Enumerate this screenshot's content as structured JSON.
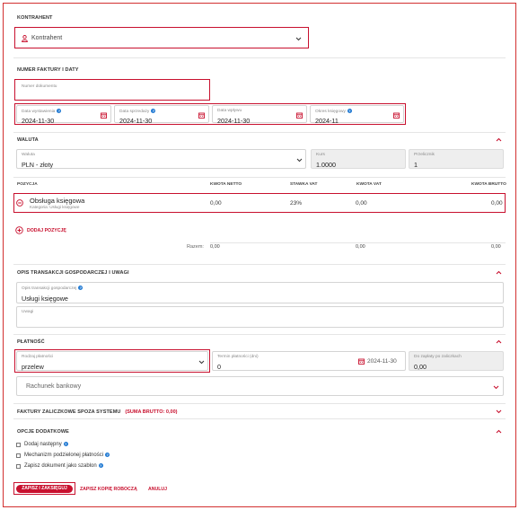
{
  "contractor": {
    "section_title": "KONTRAHENT",
    "placeholder": "Kontrahent"
  },
  "invoice": {
    "section_title": "NUMER FAKTURY I DATY",
    "number_label": "Numer dokumentu",
    "dates": [
      {
        "label": "Data wystawienia",
        "value": "2024-11-30",
        "help": true
      },
      {
        "label": "Data sprzedaży",
        "value": "2024-11-30",
        "help": true
      },
      {
        "label": "Data wpływu",
        "value": "2024-11-30",
        "help": false
      },
      {
        "label": "Okres księgowy",
        "value": "2024-11",
        "help": true
      }
    ]
  },
  "currency": {
    "section_title": "WALUTA",
    "currency_label": "Waluta",
    "currency_value": "PLN - złoty",
    "rate_label": "Kurs",
    "rate_value": "1.0000",
    "converter_label": "Przelicznik",
    "converter_value": "1"
  },
  "positions": {
    "headers": [
      "POZYCJA",
      "KWOTA NETTO",
      "STAWKA VAT",
      "KWOTA VAT",
      "KWOTA BRUTTO"
    ],
    "rows": [
      {
        "name": "Obsługa księgowa",
        "category": "Kategoria: Usługi księgowe",
        "netto": "0,00",
        "vat_rate": "23%",
        "vat": "0,00",
        "brutto": "0,00"
      }
    ],
    "add_label": "DODAJ POZYCJĘ",
    "total_label": "Razem:",
    "totals": {
      "netto": "0,00",
      "vat": "0,00",
      "brutto": "0,00"
    }
  },
  "transaction": {
    "section_title": "OPIS TRANSAKCJI GOSPODARCZEJ I UWAGI",
    "desc_label": "Opis transakcji gospodarczej",
    "desc_value": "Usługi księgowe",
    "notes_label": "Uwagi"
  },
  "payment": {
    "section_title": "PŁATNOŚĆ",
    "type_label": "Rodzaj płatności",
    "type_value": "przelew",
    "term_label": "Termin płatności (dni)",
    "term_value": "0",
    "due_date": "2024-11-30",
    "paid_label": "Do zapłaty po zaliczkach",
    "paid_value": "0,00",
    "bank_placeholder": "Rachunek bankowy"
  },
  "advance": {
    "section_title": "FAKTURY ZALICZKOWE SPOZA SYSTEMU",
    "sum_label": "(SUMA BRUTTO: 0,00)"
  },
  "options": {
    "section_title": "OPCJE DODATKOWE",
    "items": [
      "Dodaj następny",
      "Mechanizm podzielonej płatności",
      "Zapisz dokument jako szablon"
    ]
  },
  "actions": {
    "save_label": "ZAPISZ I ZAKSIĘGUJ",
    "draft_label": "ZAPISZ KOPIĘ ROBOCZĄ",
    "cancel_label": "ANULUJ"
  },
  "colors": {
    "accent": "#c8102e",
    "help": "#1e78d2"
  }
}
